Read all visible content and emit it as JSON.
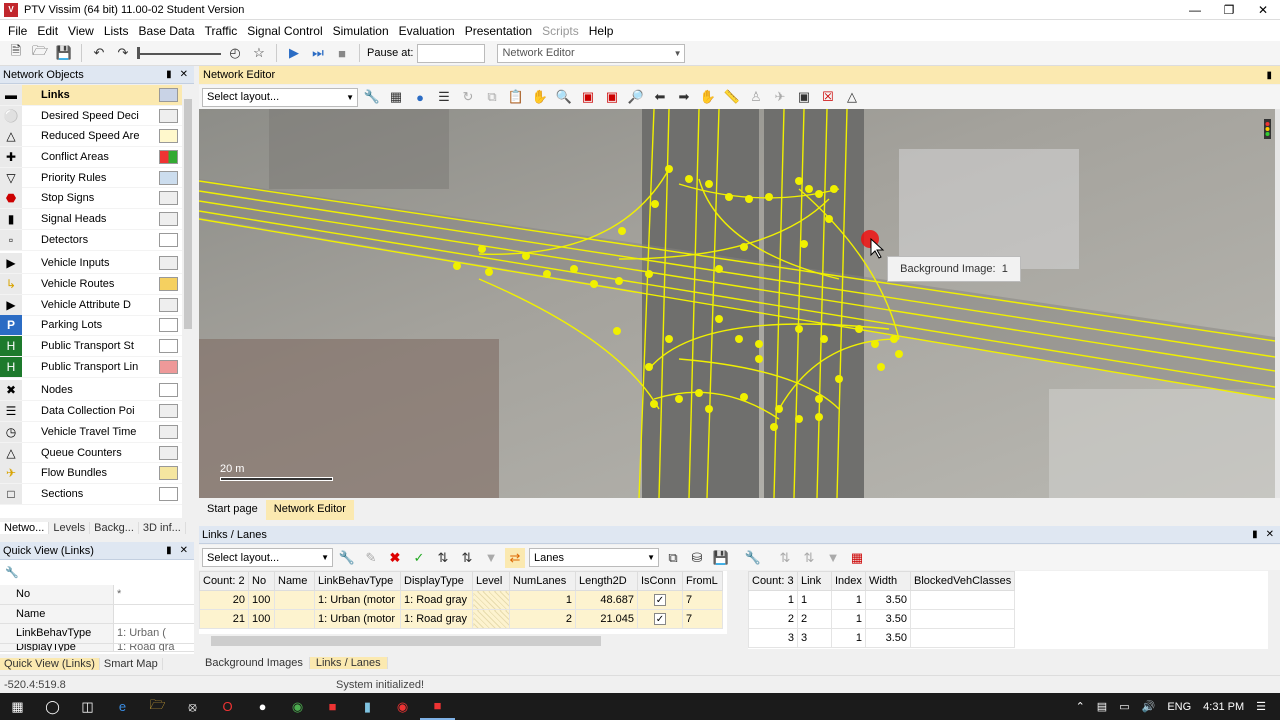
{
  "title_bar": {
    "app_icon": "vissim-logo",
    "title": "PTV Vissim (64 bit) 11.00-02 Student Version"
  },
  "menu": [
    "File",
    "Edit",
    "View",
    "Lists",
    "Base Data",
    "Traffic",
    "Signal Control",
    "Simulation",
    "Evaluation",
    "Presentation",
    "Scripts",
    "Help"
  ],
  "toolbar": {
    "pause_label": "Pause at:",
    "pause_value": "",
    "editor_select": "Network Editor"
  },
  "network_objects": {
    "header": "Network Objects",
    "items": [
      {
        "label": "Links",
        "icon": "links-icon",
        "swatch": "#c9d3e6",
        "bold": true
      },
      {
        "label": "Desired Speed Deci",
        "icon": "speed-50-icon",
        "swatch": "#eee"
      },
      {
        "label": "Reduced Speed Are",
        "icon": "warning-triangle-icon",
        "swatch": "#fff8cc"
      },
      {
        "label": "Conflict Areas",
        "icon": "conflict-area-icon",
        "swatch": "#d33"
      },
      {
        "label": "Priority Rules",
        "icon": "yield-icon",
        "swatch": "#cde"
      },
      {
        "label": "Stop Signs",
        "icon": "stop-sign-icon",
        "swatch": "#eee"
      },
      {
        "label": "Signal Heads",
        "icon": "signal-head-icon",
        "swatch": "#eee"
      },
      {
        "label": "Detectors",
        "icon": "detector-icon",
        "swatch": "#fff"
      },
      {
        "label": "Vehicle Inputs",
        "icon": "vehicle-input-icon",
        "swatch": "#eee"
      },
      {
        "label": "Vehicle Routes",
        "icon": "vehicle-route-icon",
        "swatch": "#f5d060"
      },
      {
        "label": "Vehicle Attribute D",
        "icon": "vehicle-attribute-icon",
        "swatch": "#eee"
      },
      {
        "label": "Parking Lots",
        "icon": "parking-icon",
        "swatch": "#fff"
      },
      {
        "label": "Public Transport St",
        "icon": "pt-stop-icon",
        "swatch": "#fff"
      },
      {
        "label": "Public Transport Lin",
        "icon": "pt-line-icon",
        "swatch": "#e99"
      },
      {
        "label": "Nodes",
        "icon": "nodes-icon",
        "swatch": "#fff"
      },
      {
        "label": "Data Collection Poi",
        "icon": "data-collection-icon",
        "swatch": "#eee"
      },
      {
        "label": "Vehicle Travel Time",
        "icon": "travel-time-icon",
        "swatch": "#eee"
      },
      {
        "label": "Queue Counters",
        "icon": "queue-counter-icon",
        "swatch": "#eee"
      },
      {
        "label": "Flow Bundles",
        "icon": "flow-bundle-icon",
        "swatch": "#f5e6a0"
      },
      {
        "label": "Sections",
        "icon": "sections-icon",
        "swatch": "#fff"
      }
    ],
    "tabs": [
      "Netwo...",
      "Levels",
      "Backg...",
      "3D inf..."
    ]
  },
  "quick_view": {
    "header": "Quick View (Links)",
    "rows": [
      {
        "key": "No",
        "value": "*"
      },
      {
        "key": "Name",
        "value": ""
      },
      {
        "key": "LinkBehavType",
        "value": "1: Urban ("
      },
      {
        "key": "DisplayType",
        "value": "1: Road gra"
      }
    ],
    "tabs": [
      "Quick View (Links)",
      "Smart Map"
    ]
  },
  "editor": {
    "header": "Network Editor",
    "layout_select": "Select layout...",
    "tooltip": {
      "label": "Background Image:",
      "value": "1"
    },
    "scale_label": "20 m",
    "tabs": [
      "Start page",
      "Network Editor"
    ]
  },
  "links_lanes": {
    "header": "Links / Lanes",
    "layout_select": "Select layout...",
    "relation_select": "Lanes",
    "left_table": {
      "columns": [
        "Count: 2",
        "No",
        "Name",
        "LinkBehavType",
        "DisplayType",
        "Level",
        "NumLanes",
        "Length2D",
        "IsConn",
        "FromL"
      ],
      "rows": [
        [
          "20",
          "100",
          "",
          "1: Urban (motor",
          "1: Road gray",
          "",
          "1",
          "48.687",
          "checkbox",
          "7"
        ],
        [
          "21",
          "100",
          "",
          "1: Urban (motor",
          "1: Road gray",
          "",
          "2",
          "21.045",
          "checkbox",
          "7"
        ]
      ]
    },
    "right_table": {
      "columns": [
        "Count: 3",
        "Link",
        "Index",
        "Width",
        "BlockedVehClasses"
      ],
      "rows": [
        [
          "1",
          "1",
          "1",
          "3.50",
          ""
        ],
        [
          "2",
          "2",
          "1",
          "3.50",
          ""
        ],
        [
          "3",
          "3",
          "1",
          "3.50",
          ""
        ]
      ]
    },
    "tabs": [
      "Background Images",
      "Links / Lanes"
    ]
  },
  "status": {
    "coords": "-520.4:519.8",
    "message": "System initialized!"
  },
  "taskbar": {
    "lang": "ENG",
    "time": "4:31 PM"
  }
}
